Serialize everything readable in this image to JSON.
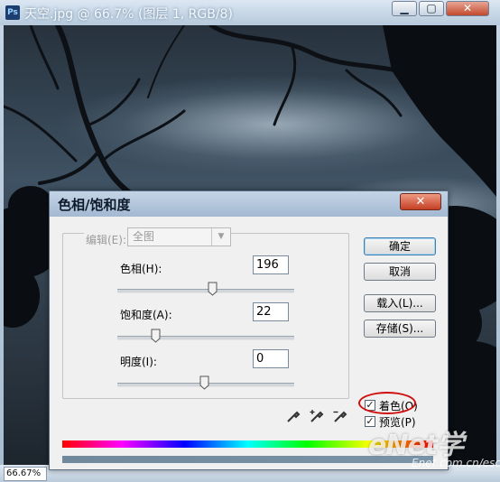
{
  "document": {
    "title": "天空.jpg @ 66.7% (图层 1, RGB/8)",
    "app_icon": "Ps",
    "zoom": "66.67%",
    "window_buttons": [
      "minimize-icon",
      "maximize-icon",
      "close-icon"
    ],
    "window_button_glyphs": {
      "minimize": "▁",
      "maximize": "▢",
      "close": "✕"
    }
  },
  "dialog": {
    "title": "色相/饱和度",
    "close_glyph": "✕",
    "edit": {
      "label": "编辑(E):",
      "value": "全图",
      "disabled": true
    },
    "hue": {
      "label": "色相(H):",
      "value": "196",
      "min": -180,
      "max": 180
    },
    "saturation": {
      "label": "饱和度(A):",
      "value": "22",
      "min": -100,
      "max": 100
    },
    "lightness": {
      "label": "明度(I):",
      "value": "0",
      "min": -100,
      "max": 100
    },
    "buttons": {
      "ok": "确定",
      "cancel": "取消",
      "load": "载入(L)...",
      "save": "存储(S)..."
    },
    "colorize": {
      "label": "着色(O)",
      "checked": true
    },
    "preview": {
      "label": "预览(P)",
      "checked": true
    },
    "tools": [
      "eyedropper-icon",
      "eyedropper-plus-icon",
      "eyedropper-minus-icon"
    ]
  },
  "watermark": {
    "brand": "eNet学",
    "url": "Enet.com.cn/eschool"
  },
  "colors": {
    "accent": "#3c7fb1",
    "annotation": "#d01010",
    "colorize_bar": "#70899c"
  }
}
